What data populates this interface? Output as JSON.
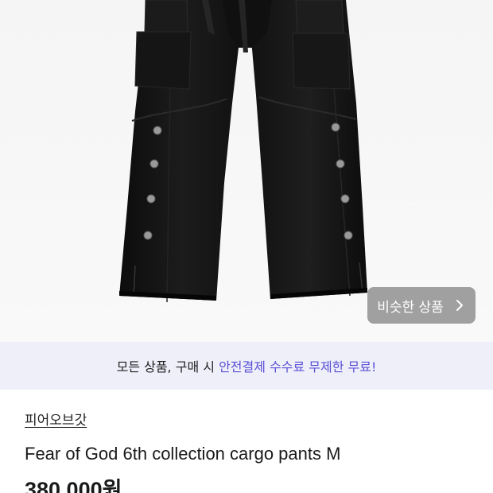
{
  "product_image": {
    "alt_icon": "cargo-pants-photo"
  },
  "similar_products_button": {
    "label": "비슷한 상품",
    "icon": "chevron-right-icon"
  },
  "banner": {
    "prefix": "모든 상품, 구매 시 ",
    "highlight": "안전결제 수수료 무제한 무료!"
  },
  "product": {
    "shop_name": "피어오브갓",
    "title": "Fear of God 6th collection cargo pants M",
    "price": "380,000원"
  },
  "colors": {
    "banner_bg": "#eeeff9",
    "highlight": "#5b4fd6",
    "button_bg": "#8c8c8c"
  }
}
